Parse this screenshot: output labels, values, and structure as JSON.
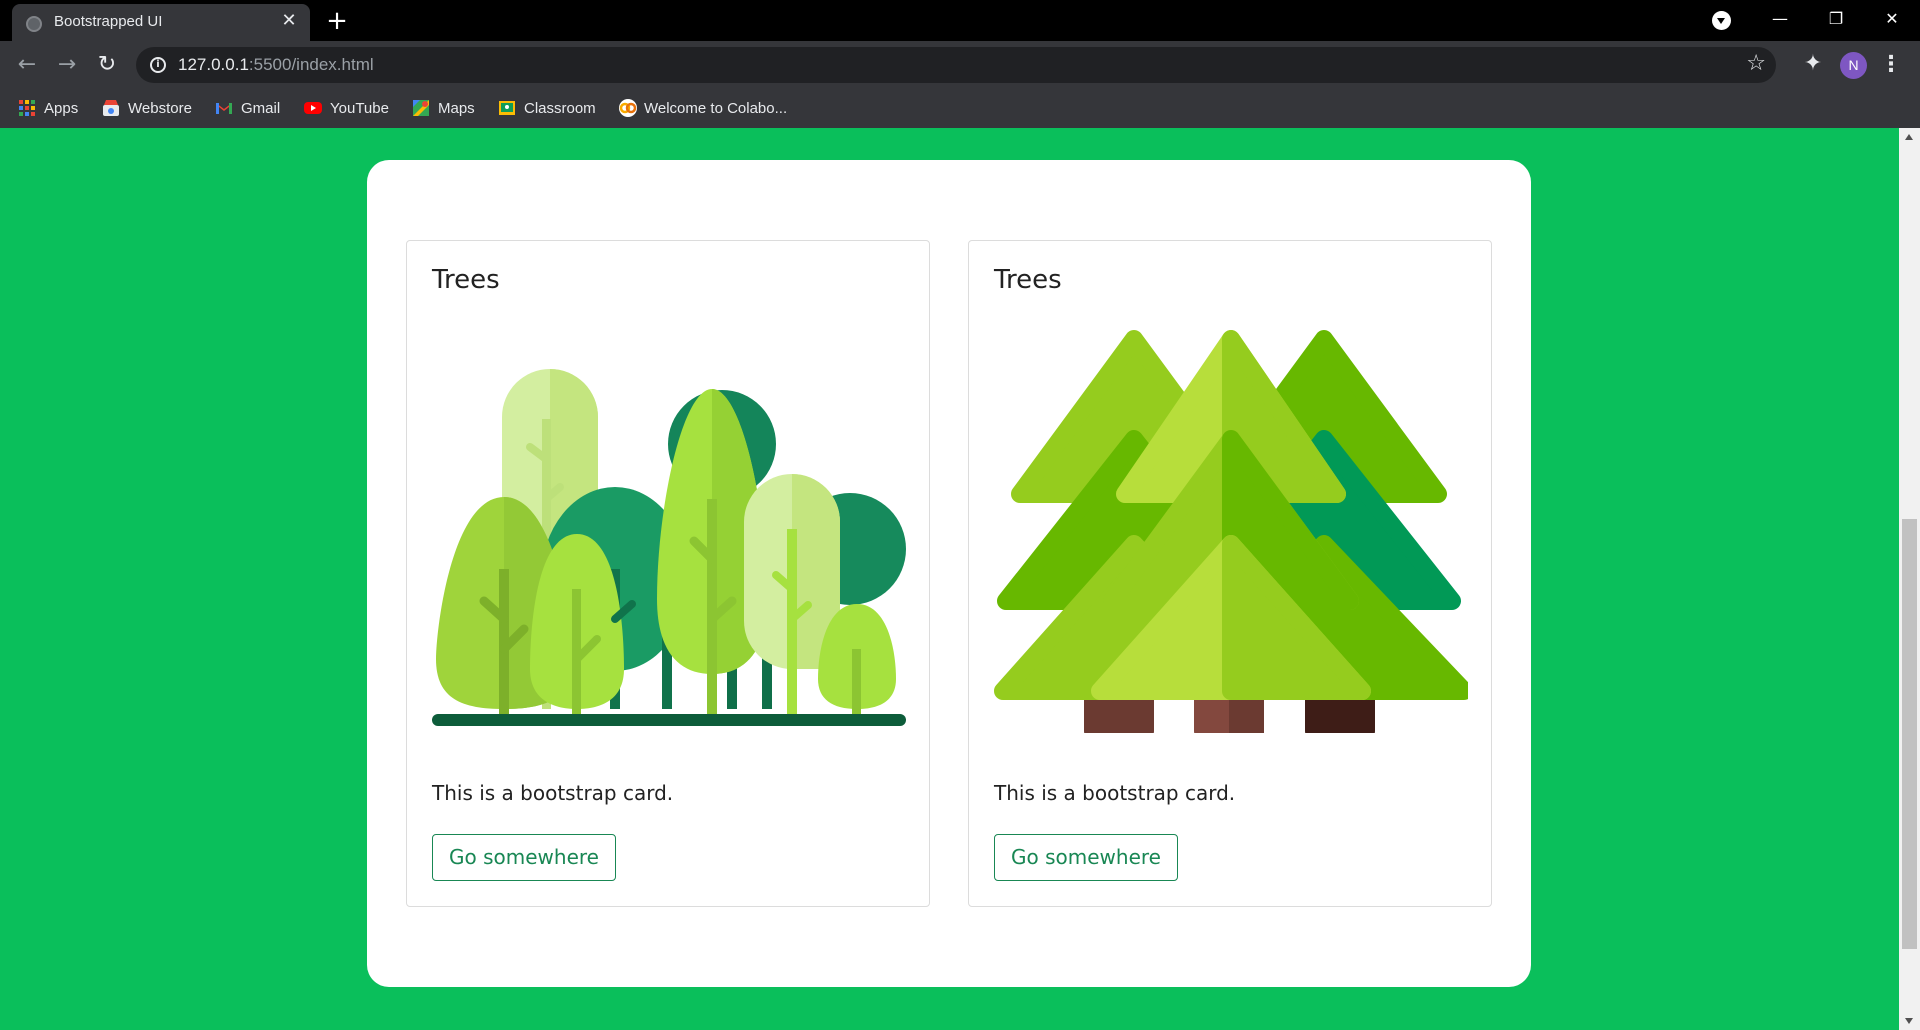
{
  "browser": {
    "tab_title": "Bootstrapped UI",
    "tab_close": "✕",
    "new_tab": "+",
    "url_host": "127.0.0.1",
    "url_path": ":5500/index.html",
    "profile_initial": "N",
    "window_controls": {
      "minimize": "—",
      "restore": "❐",
      "close": "✕"
    },
    "nav": {
      "back": "←",
      "forward": "→",
      "reload": "↻"
    },
    "menu": "⋮",
    "bookmarks": [
      {
        "label": "Apps",
        "icon": "apps-grid-icon"
      },
      {
        "label": "Webstore",
        "icon": "webstore-icon"
      },
      {
        "label": "Gmail",
        "icon": "gmail-icon"
      },
      {
        "label": "YouTube",
        "icon": "youtube-icon"
      },
      {
        "label": "Maps",
        "icon": "maps-icon"
      },
      {
        "label": "Classroom",
        "icon": "classroom-icon"
      },
      {
        "label": "Welcome to Colabo...",
        "icon": "colab-icon"
      }
    ]
  },
  "page": {
    "background_color": "#0abf5b",
    "accent_color": "#198754",
    "cards": [
      {
        "title": "Trees",
        "image": "deciduous-forest-illustration",
        "text": "This is a bootstrap card.",
        "button_label": "Go somewhere"
      },
      {
        "title": "Trees",
        "image": "pine-trees-illustration",
        "text": "This is a bootstrap card.",
        "button_label": "Go somewhere"
      }
    ]
  }
}
